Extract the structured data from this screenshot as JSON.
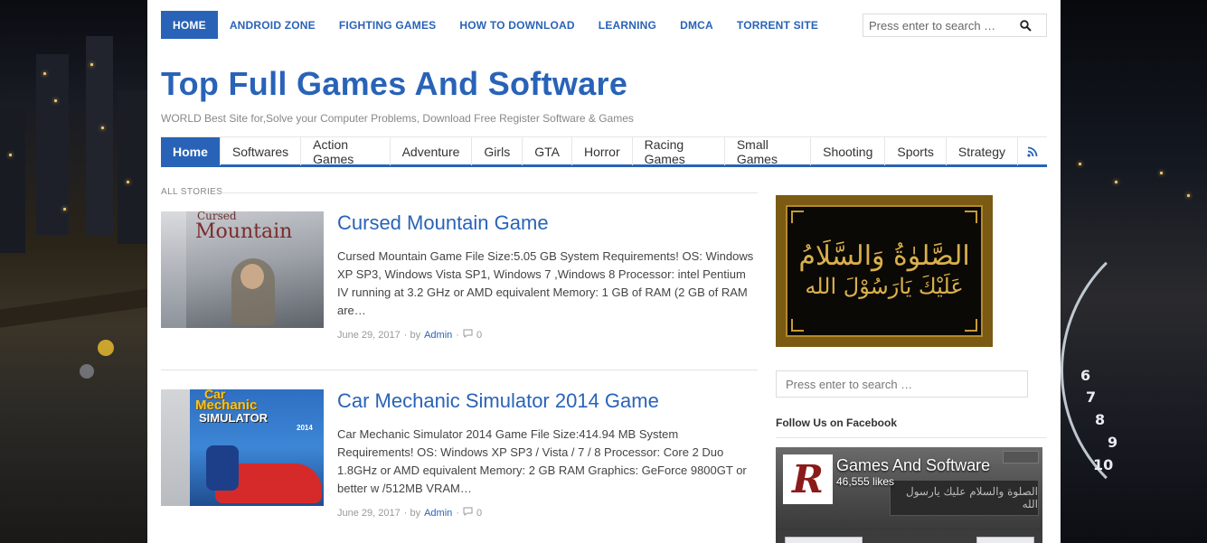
{
  "top_nav": {
    "items": [
      {
        "label": "HOME",
        "active": true
      },
      {
        "label": "ANDROID ZONE"
      },
      {
        "label": "FIGHTING GAMES"
      },
      {
        "label": "HOW TO DOWNLOAD"
      },
      {
        "label": "LEARNING"
      },
      {
        "label": "DMCA"
      },
      {
        "label": "TORRENT SITE"
      }
    ],
    "search_placeholder": "Press enter to search …",
    "search_icon": "search-icon"
  },
  "site": {
    "title": "Top Full Games And Software",
    "tagline": "WORLD Best Site for,Solve your Computer Problems, Download Free Register Software & Games"
  },
  "main_nav": {
    "items": [
      {
        "label": "Home",
        "active": true
      },
      {
        "label": "Softwares"
      },
      {
        "label": "Action Games"
      },
      {
        "label": "Adventure"
      },
      {
        "label": "Girls"
      },
      {
        "label": "GTA"
      },
      {
        "label": "Horror"
      },
      {
        "label": "Racing Games"
      },
      {
        "label": "Small Games"
      },
      {
        "label": "Shooting"
      },
      {
        "label": "Sports"
      },
      {
        "label": "Strategy"
      }
    ],
    "rss_icon": "rss-icon"
  },
  "stories": {
    "label": "ALL STORIES",
    "posts": [
      {
        "title": "Cursed Mountain Game",
        "thumb_text_1": "Cursed",
        "thumb_text_2": "Mountain",
        "excerpt": "Cursed Mountain Game File Size:5.05 GB System Requirements! OS: Windows XP SP3, Windows Vista SP1, Windows 7 ,Windows 8 Processor: intel Pentium IV running at 3.2 GHz or AMD equivalent Memory: 1 GB of RAM (2 GB of RAM are…",
        "date": "June 29, 2017",
        "by": "· by",
        "author": "Admin",
        "comments": "0"
      },
      {
        "title": "Car Mechanic Simulator 2014 Game",
        "thumb_text_1": "Car",
        "thumb_text_2": "Mechanic",
        "thumb_text_3": "SIMULATOR",
        "thumb_text_4": "2014",
        "excerpt": "Car Mechanic Simulator 2014 Game File Size:414.94 MB System Requirements! OS: Windows XP SP3 / Vista / 7 / 8 Processor: Core 2 Duo 1.8GHz or AMD equivalent Memory: 2 GB RAM Graphics: GeForce 9800GT or better w /512MB VRAM…",
        "date": "June 29, 2017",
        "by": "· by",
        "author": "Admin",
        "comments": "0"
      }
    ]
  },
  "sidebar": {
    "ad_line_1": "الصَّلوٰةُ وَالسَّلَامُ",
    "ad_line_2": "عَلَيْكَ يَارَسُوْلَ الله",
    "search_placeholder": "Press enter to search …",
    "follow_title": "Follow Us on Facebook",
    "fb": {
      "logo_letter": "R",
      "page_name": "Games And Software",
      "likes": "46,555 likes",
      "cover_text": "الصلوة والسلام عليك يارسول الله"
    }
  },
  "background": {
    "gauge_numbers": [
      "6",
      "7",
      "8",
      "9",
      "10"
    ]
  },
  "colors": {
    "brand_blue": "#2963b8",
    "text_gray": "#444444",
    "meta_gray": "#999999"
  }
}
